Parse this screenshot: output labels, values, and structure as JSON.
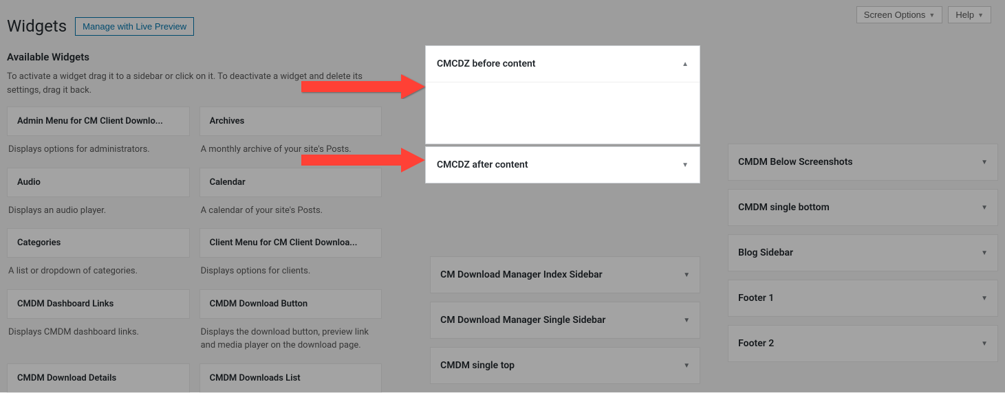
{
  "top_bar": {
    "screen_options": "Screen Options",
    "help": "Help"
  },
  "page": {
    "title": "Widgets",
    "live_preview": "Manage with Live Preview",
    "available_title": "Available Widgets",
    "description": "To activate a widget drag it to a sidebar or click on it. To deactivate a widget and delete its settings, drag it back."
  },
  "widgets": [
    {
      "title": "Admin Menu for CM Client Downlo...",
      "desc": "Displays options for administrators."
    },
    {
      "title": "Archives",
      "desc": "A monthly archive of your site's Posts."
    },
    {
      "title": "Audio",
      "desc": "Displays an audio player."
    },
    {
      "title": "Calendar",
      "desc": "A calendar of your site's Posts."
    },
    {
      "title": "Categories",
      "desc": "A list or dropdown of categories."
    },
    {
      "title": "Client Menu for CM Client Downloa...",
      "desc": "Displays options for clients."
    },
    {
      "title": "CMDM Dashboard Links",
      "desc": "Displays CMDM dashboard links."
    },
    {
      "title": "CMDM Download Button",
      "desc": "Displays the download button, preview link and media player on the download page."
    },
    {
      "title": "CMDM Download Details",
      "desc": ""
    },
    {
      "title": "CMDM Downloads List",
      "desc": ""
    }
  ],
  "highlight_areas": [
    {
      "title": "CMCDZ before content",
      "expanded": true
    },
    {
      "title": "CMCDZ after content",
      "expanded": false
    }
  ],
  "mid_areas": [
    {
      "title": "CM Download Manager Index Sidebar"
    },
    {
      "title": "CM Download Manager Single Sidebar"
    },
    {
      "title": "CMDM single top"
    }
  ],
  "right_areas": [
    {
      "title": "CMDM Below Screenshots"
    },
    {
      "title": "CMDM single bottom"
    },
    {
      "title": "Blog Sidebar"
    },
    {
      "title": "Footer 1"
    },
    {
      "title": "Footer 2"
    }
  ]
}
